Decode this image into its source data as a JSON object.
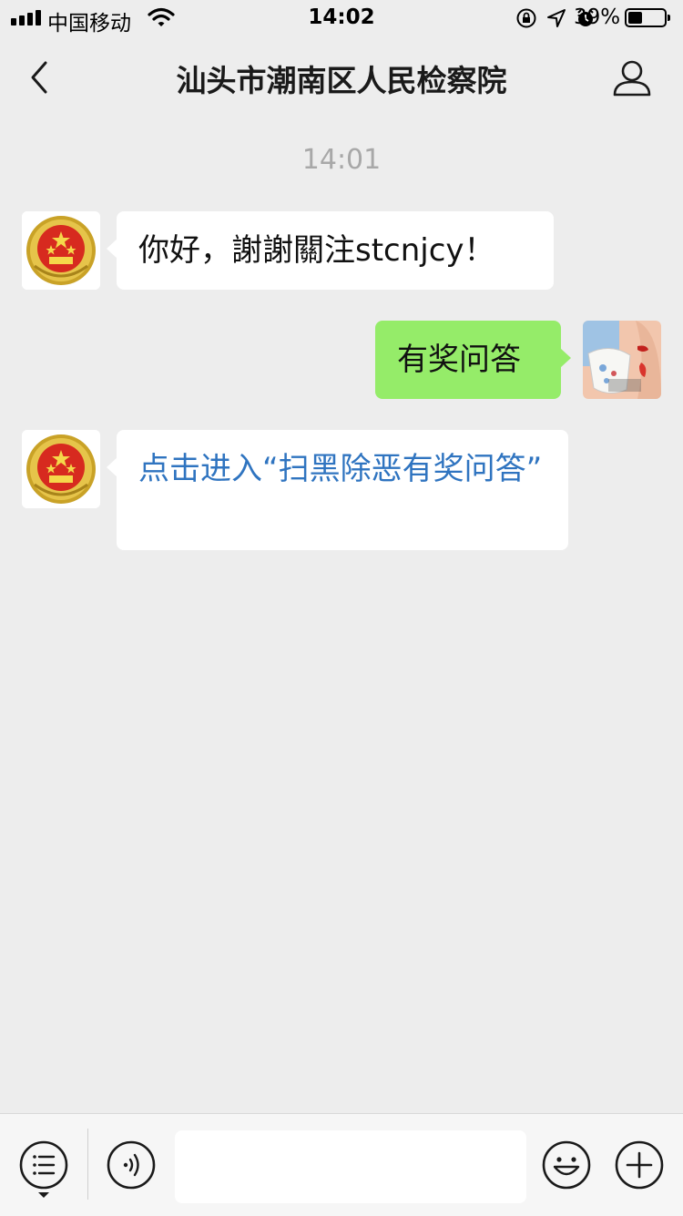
{
  "status_bar": {
    "carrier": "中国移动",
    "time": "14:02",
    "battery_percent": "39%",
    "battery_level": 0.39
  },
  "nav": {
    "title": "汕头市潮南区人民检察院"
  },
  "chat": {
    "timestamp": "14:01",
    "messages": [
      {
        "direction": "in",
        "text": "你好，謝謝關注stcnjcy！"
      },
      {
        "direction": "out",
        "text": "有奖问答"
      },
      {
        "direction": "in",
        "text": "点击进入“扫黑除恶有奖问答”",
        "is_link": true
      }
    ]
  },
  "colors": {
    "background": "#ededed",
    "outgoing_bubble": "#95ec69",
    "incoming_bubble": "#ffffff",
    "link": "#2f74c0"
  },
  "icons": [
    "back-icon",
    "profile-icon",
    "menu-list-icon",
    "voice-icon",
    "emoji-icon",
    "plus-icon",
    "wifi-icon",
    "lock-rotation-icon",
    "location-icon",
    "alarm-icon"
  ]
}
